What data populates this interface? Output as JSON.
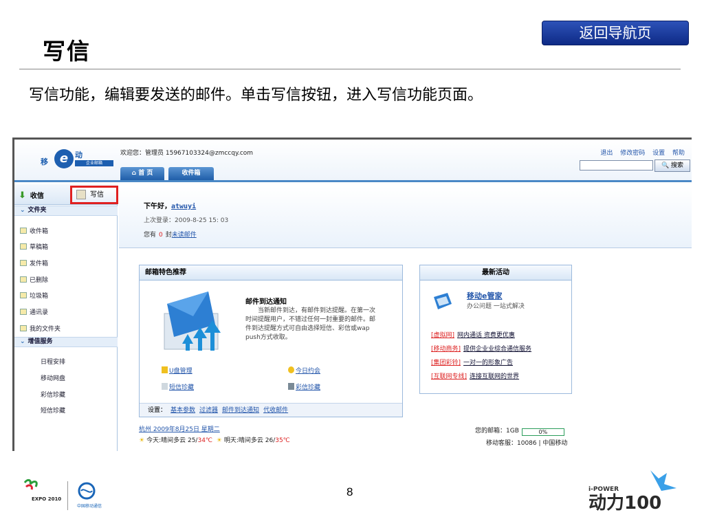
{
  "slide": {
    "title": "写信",
    "back_button": "返回导航页",
    "description": "写信功能，编辑要发送的邮件。单击写信按钮，进入写信功能页面。",
    "page_number": "8"
  },
  "mail_app": {
    "logo_text": "移",
    "logo_sub": "企业邮箱",
    "logo_mark": "动",
    "welcome": "欢迎您：管理员 15967103324@zmccqy.com",
    "top_links": [
      "退出",
      "修改密码",
      "设置",
      "帮助"
    ],
    "search_button": "搜索",
    "nav_tabs": [
      "首 页",
      "收件箱"
    ],
    "left": {
      "inbox_button": "收信",
      "write_button": "写信",
      "folder_section": "文件夹",
      "folders": [
        "收件箱",
        "草稿箱",
        "发件箱",
        "已删除",
        "垃圾箱",
        "通讯录",
        "我的文件夹"
      ],
      "service_section": "增值服务",
      "services": [
        "日程安排",
        "移动网盘",
        "彩信珍藏",
        "短信珍藏"
      ]
    },
    "greeting": {
      "hello": "下午好，",
      "user": "atwuyi",
      "last_login": "上次登录：2009-8-25  15: 03",
      "unread_prefix": "您有",
      "unread_count": "0",
      "unread_suffix": "封",
      "unread_link": "未读邮件"
    },
    "features": {
      "header": "邮箱特色推荐",
      "title": "邮件到达通知",
      "body": "当新邮件到达，有邮件到达提醒。在第一次时间提醒用户，不错过任何一封重要的邮件。邮件到达提醒方式可自由选择短信、彩信或wap push方式收取。",
      "links": [
        "U盘管理",
        "今日约会",
        "短信珍藏",
        "彩信珍藏"
      ],
      "settings_label": "设置：",
      "settings_links": [
        "基本参数",
        "过滤器",
        "邮件到达通知",
        "代收邮件"
      ]
    },
    "activities": {
      "header": "最新活动",
      "manager_title": "移动e管家",
      "manager_sub": "办公问题 一站式解决",
      "promos": [
        {
          "tag": "[虚拟网]",
          "text": "网内通话 资费更优惠"
        },
        {
          "tag": "[移动商务]",
          "text": "提供企业业综合通信服务"
        },
        {
          "tag": "[集团彩铃]",
          "text": "一对一的形象广告"
        },
        {
          "tag": "[互联网专线]",
          "text": "连接互联网的世界"
        }
      ]
    },
    "weather": {
      "city_date": "杭州  2009年8月25日  星期二",
      "today_label": "今天:晴间多云 25/",
      "today_high": "34℃",
      "tomorrow_label": "明天:晴间多云 26/",
      "tomorrow_high": "35℃"
    },
    "mailbox": {
      "label": "您的邮箱：1GB",
      "usage": "0%",
      "service": "移动客服：10086  |  中国移动"
    }
  },
  "footer": {
    "expo_text": "EXPO 2010",
    "cmcc_text": "中国移动通信",
    "ipower_text": "i-POWER",
    "ipower_brand": "动力100"
  },
  "colors": {
    "accent_blue": "#1d5fb0",
    "back_button": "#1a3a9e",
    "highlight_red": "#e02020"
  }
}
